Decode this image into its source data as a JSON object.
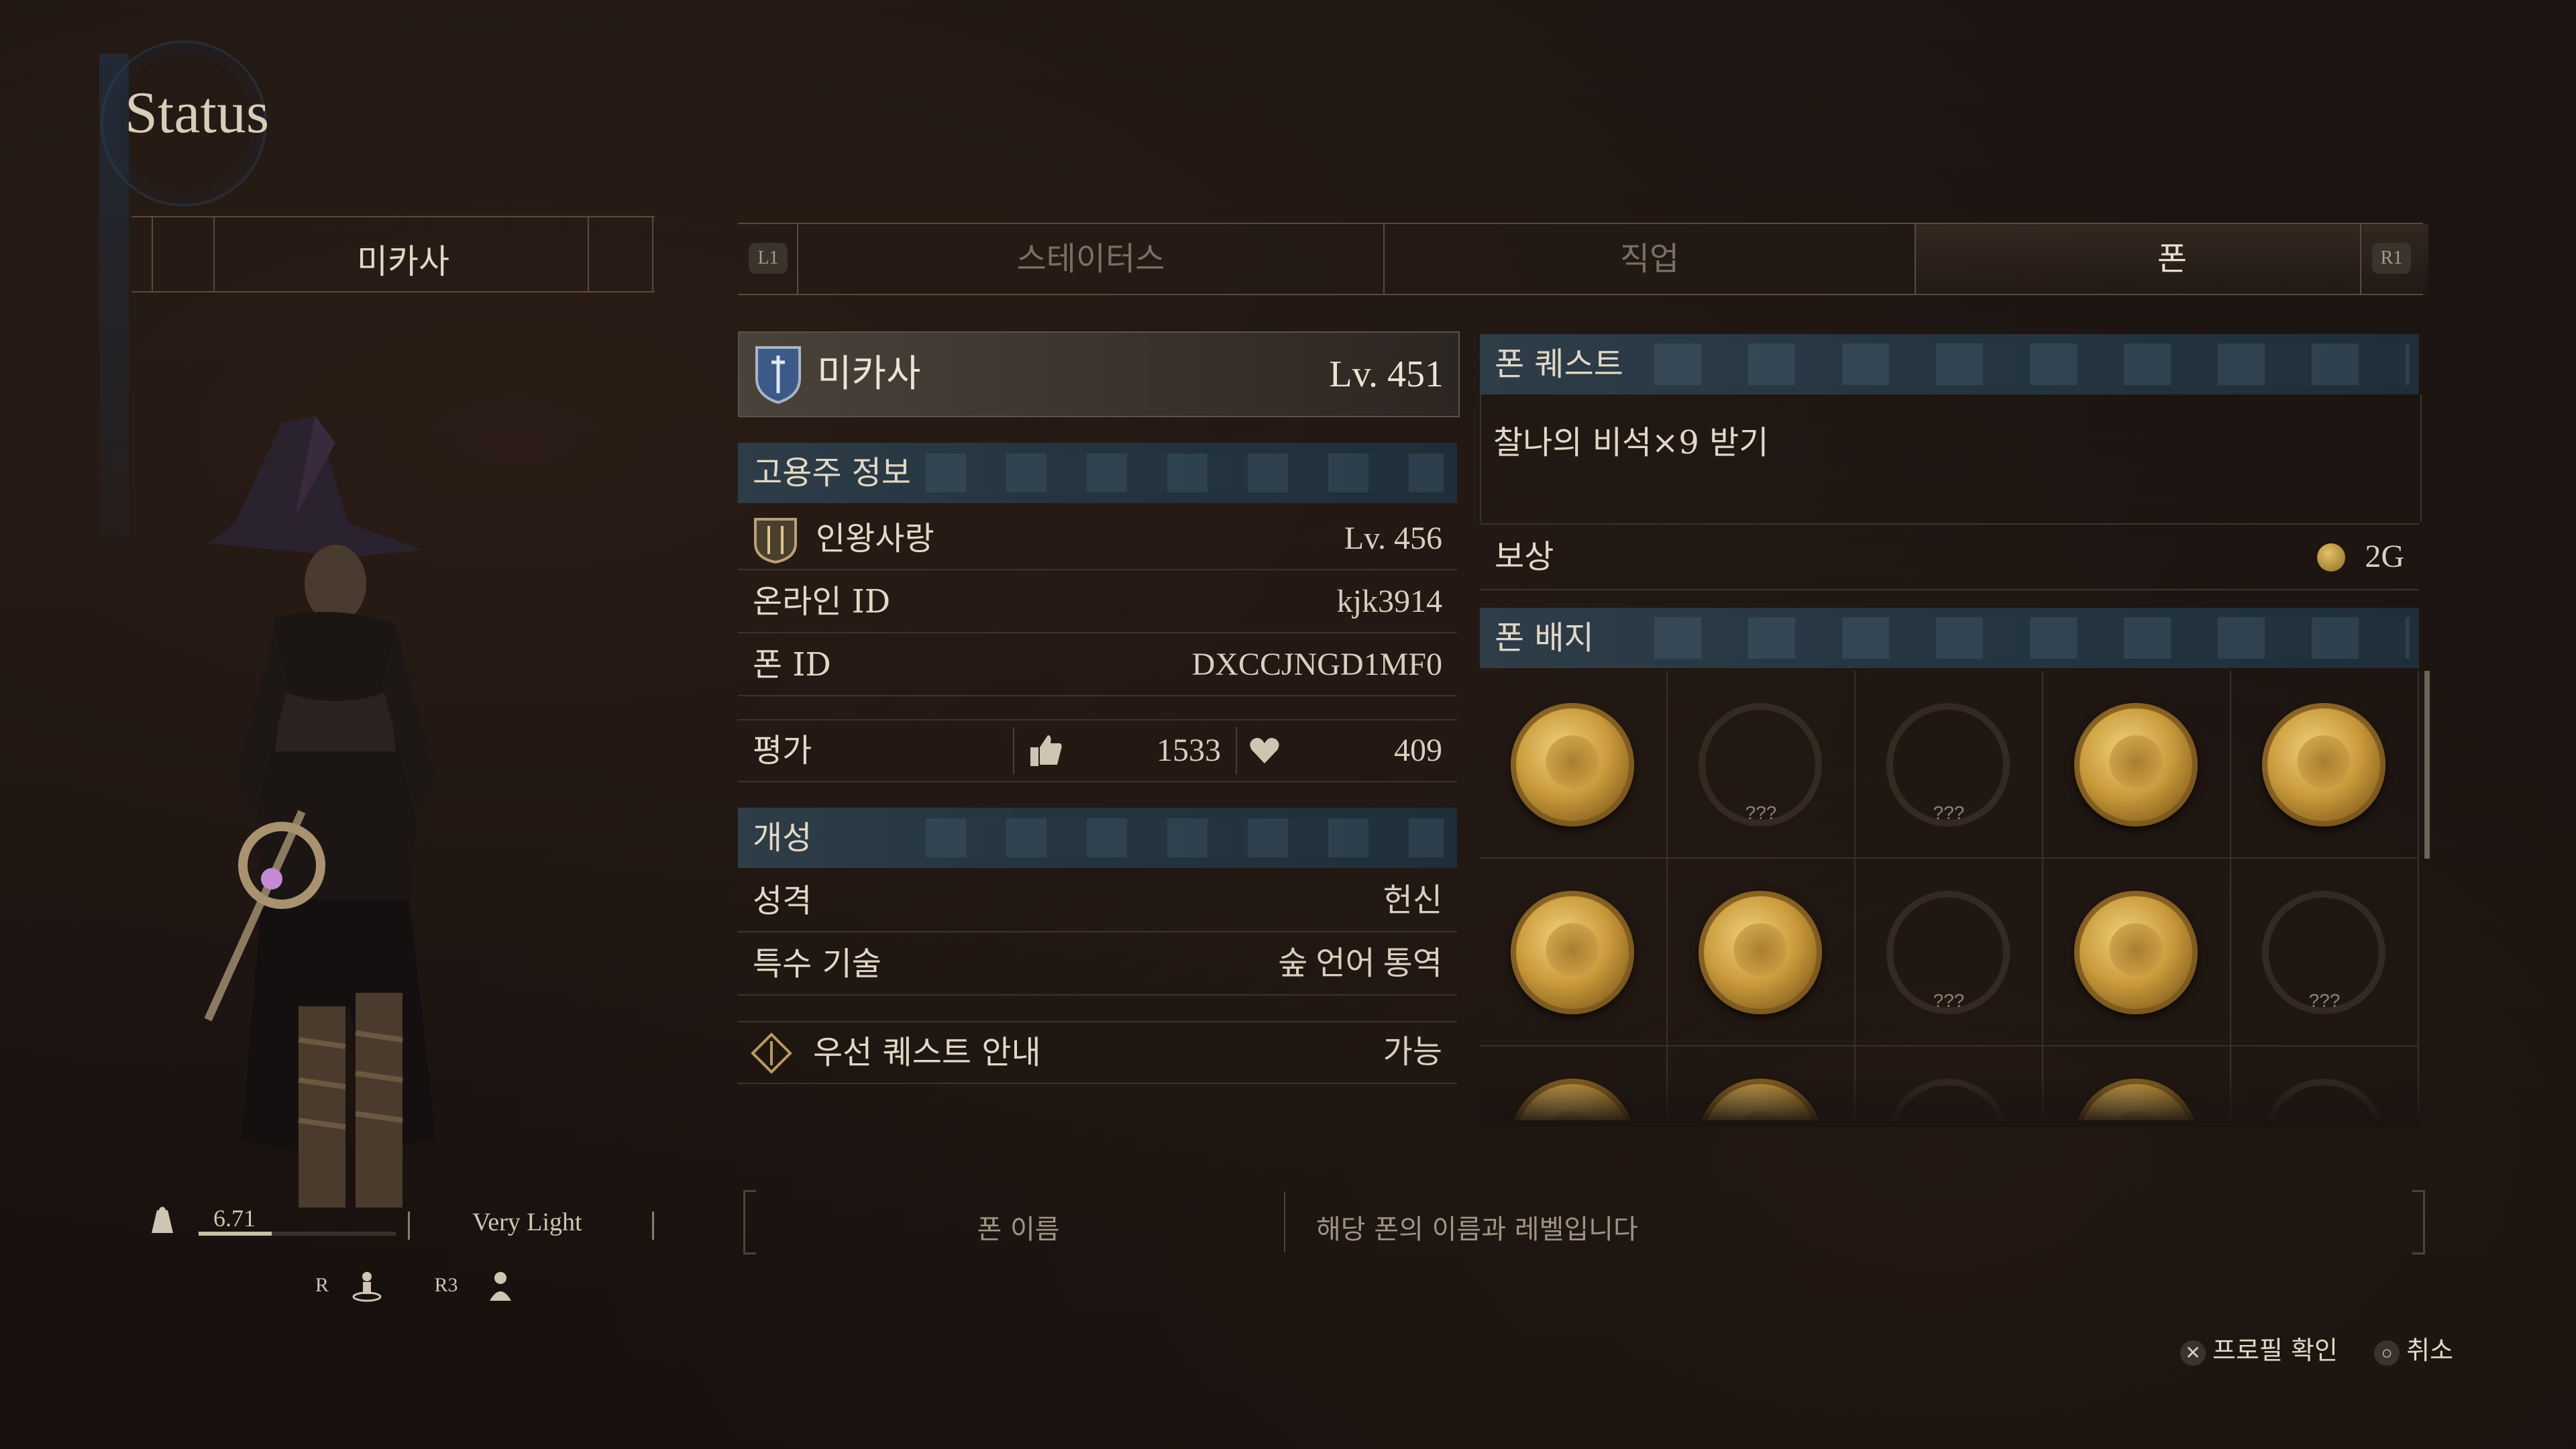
{
  "screen": {
    "title": "Status"
  },
  "character": {
    "name": "미카사",
    "weight_value": "6.71",
    "weight_class": "Very Light",
    "weight_fill": 0.37,
    "controls": {
      "rotate_button": "R",
      "reset_button": "R3"
    }
  },
  "tabs": {
    "left_button": "L1",
    "right_button": "R1",
    "items": [
      {
        "label": "스테이터스"
      },
      {
        "label": "직업"
      },
      {
        "label": "폰"
      }
    ],
    "active_index": 2
  },
  "pawn": {
    "name": "미카사",
    "level": "Lv.  451",
    "employer_header": "고용주 정보",
    "employer_name": "인왕사랑",
    "employer_level": "Lv. 456",
    "online_id_label": "온라인 ID",
    "online_id": "kjk3914",
    "pawn_id_label": "폰 ID",
    "pawn_id": "DXCCJNGD1MF0",
    "rating_label": "평가",
    "thumbs_count": "1533",
    "hearts_count": "409",
    "personality_header": "개성",
    "personality_label": "성격",
    "personality_value": "헌신",
    "skill_label": "특수 기술",
    "skill_value": "숲 언어 통역",
    "guide_label": "우선 퀘스트 안내",
    "guide_value": "가능"
  },
  "quest": {
    "header": "폰 퀘스트",
    "text": "찰나의 비석×9 받기",
    "reward_label": "보상",
    "reward_value": "2G"
  },
  "badges": {
    "header": "폰 배지",
    "locked_text": "???",
    "grid": [
      {
        "unlocked": true,
        "icon": "monster-badge-icon"
      },
      {
        "unlocked": false,
        "icon": "locked-badge-icon"
      },
      {
        "unlocked": false,
        "icon": "locked-badge-icon"
      },
      {
        "unlocked": true,
        "icon": "ogre-badge-icon"
      },
      {
        "unlocked": true,
        "icon": "wyvern-badge-icon"
      },
      {
        "unlocked": true,
        "icon": "griffin-badge-icon"
      },
      {
        "unlocked": true,
        "icon": "harpy-badge-icon"
      },
      {
        "unlocked": false,
        "icon": "locked-badge-icon"
      },
      {
        "unlocked": true,
        "icon": "figure-badge-icon"
      },
      {
        "unlocked": false,
        "icon": "locked-badge-icon"
      },
      {
        "unlocked": true,
        "icon": "partial-badge-icon"
      },
      {
        "unlocked": true,
        "icon": "partial-badge-icon"
      },
      {
        "unlocked": false,
        "icon": "locked-badge-icon"
      },
      {
        "unlocked": true,
        "icon": "partial-badge-icon"
      },
      {
        "unlocked": false,
        "icon": "locked-badge-icon"
      }
    ]
  },
  "help": {
    "key": "폰 이름",
    "description": "해당 폰의 이름과 레벨입니다"
  },
  "footer": {
    "confirm_label": "프로필 확인",
    "cancel_label": "취소"
  }
}
